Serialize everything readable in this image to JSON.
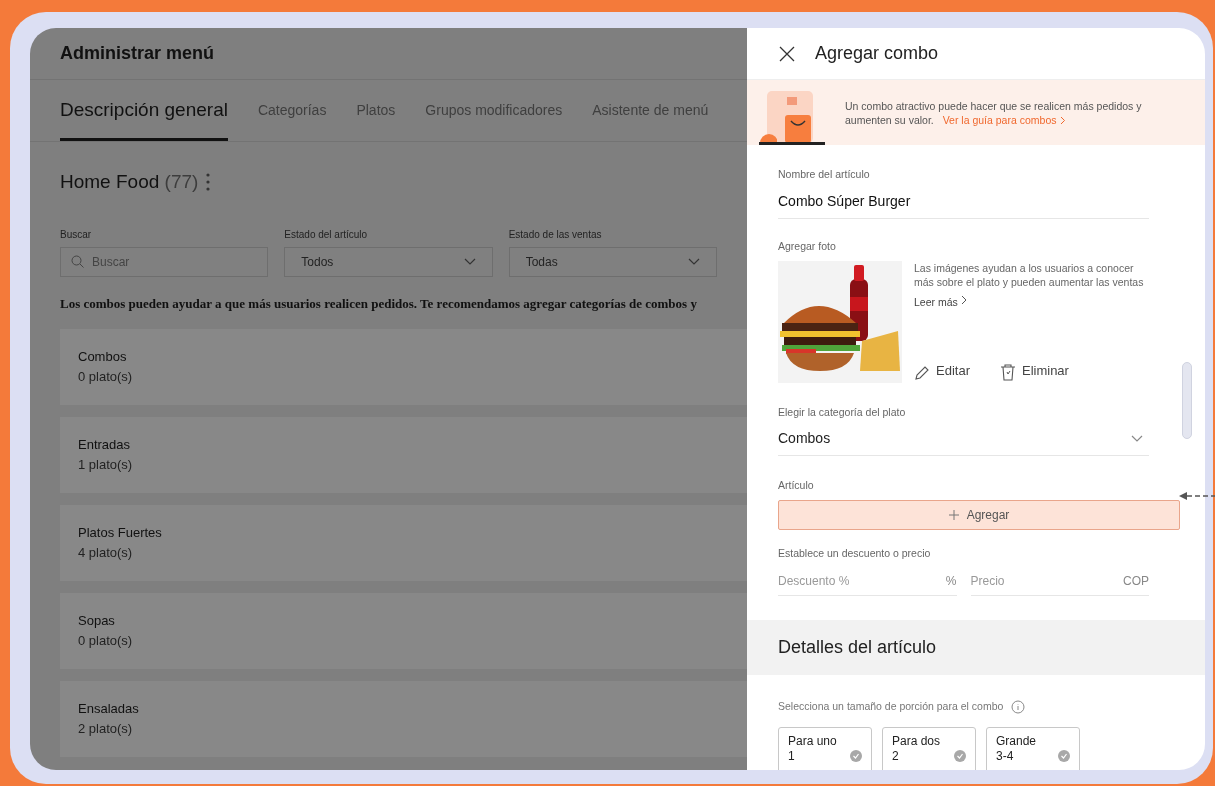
{
  "page": {
    "title": "Administrar menú",
    "tabs": [
      {
        "label": "Descripción general",
        "selected": true
      },
      {
        "label": "Categorías",
        "selected": false
      },
      {
        "label": "Platos",
        "selected": false
      },
      {
        "label": "Grupos modificadores",
        "selected": false
      },
      {
        "label": "Asistente de menú",
        "selected": false
      }
    ],
    "store": {
      "name": "Home Food",
      "count": "(77)"
    },
    "filters": [
      {
        "kind": "search",
        "label": "Buscar",
        "placeholder": "Buscar"
      },
      {
        "kind": "select",
        "label": "Estado del artículo",
        "value": "Todos"
      },
      {
        "kind": "select",
        "label": "Estado de las ventas",
        "value": "Todas"
      }
    ],
    "notice": "Los combos pueden ayudar a que más usuarios realicen pedidos. Te recomendamos agregar categorías de combos y",
    "categories": [
      {
        "name": "Combos",
        "count": "0 plato(s)"
      },
      {
        "name": "Entradas",
        "count": "1 plato(s)"
      },
      {
        "name": "Platos Fuertes",
        "count": "4 plato(s)"
      },
      {
        "name": "Sopas",
        "count": "0 plato(s)"
      },
      {
        "name": "Ensaladas",
        "count": "2 plato(s)"
      }
    ]
  },
  "drawer": {
    "title": "Agregar combo",
    "banner": {
      "text": "Un combo atractivo puede hacer que se realicen más pedidos y aumenten su valor.",
      "link": "Ver la guía para combos"
    },
    "name_field": {
      "label": "Nombre del artículo",
      "value": "Combo Súper Burger"
    },
    "photo": {
      "label": "Agregar foto",
      "hint": "Las imágenes ayudan a los usuarios a conocer más sobre el plato y pueden aumentar las ventas",
      "read_more": "Leer más",
      "actions": [
        {
          "kind": "edit",
          "label": "Editar"
        },
        {
          "kind": "delete",
          "label": "Eliminar"
        }
      ]
    },
    "category_field": {
      "label": "Elegir la categoría del plato",
      "value": "Combos"
    },
    "article": {
      "label": "Artículo",
      "button": "Agregar"
    },
    "price": {
      "label": "Establece un descuento o precio",
      "fields": [
        {
          "placeholder": "Descuento %",
          "unit": "%"
        },
        {
          "placeholder": "Precio",
          "unit": "COP"
        }
      ]
    },
    "details": {
      "title": "Detalles del artículo",
      "portion_label": "Selecciona un tamaño de porción para el combo",
      "portions": [
        {
          "name": "Para uno",
          "size": "1",
          "selected": false
        },
        {
          "name": "Para dos",
          "size": "2",
          "selected": false
        },
        {
          "name": "Grande",
          "size": "3-4",
          "selected": false
        }
      ]
    }
  }
}
